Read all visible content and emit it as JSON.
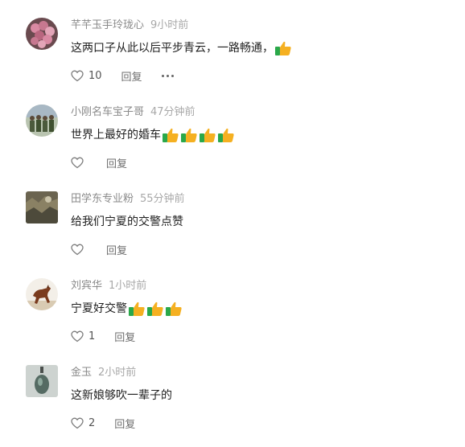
{
  "comments": [
    {
      "username": "芊芊玉手玲珑心",
      "time": "9小时前",
      "text": "这两口子从此以后平步青云，一路畅通，",
      "emoji_count": 1,
      "likes": "10",
      "reply_label": "回复",
      "has_more": true,
      "avatar": "flower-bouquet"
    },
    {
      "username": "小刚名车宝子哥",
      "time": "47分钟前",
      "text": "世界上最好的婚车",
      "emoji_count": 4,
      "likes": "",
      "reply_label": "回复",
      "has_more": false,
      "avatar": "people-group"
    },
    {
      "username": "田学东专业粉",
      "time": "55分钟前",
      "text": "给我们宁夏的交警点赞",
      "emoji_count": 0,
      "likes": "",
      "reply_label": "回复",
      "has_more": false,
      "avatar": "landscape"
    },
    {
      "username": "刘宾华",
      "time": "1小时前",
      "text": "宁夏好交警",
      "emoji_count": 3,
      "likes": "1",
      "reply_label": "回复",
      "has_more": false,
      "avatar": "running-horse"
    },
    {
      "username": "金玉",
      "time": "2小时前",
      "text": "这新娘够吹一辈子的",
      "emoji_count": 0,
      "likes": "2",
      "reply_label": "回复",
      "has_more": false,
      "avatar": "jade-pendant"
    }
  ],
  "icons": {
    "like": "heart-outline-icon",
    "more": "ellipsis-icon",
    "emoji": "thumbs-up-emoji"
  },
  "colors": {
    "username": "#8a8a8a",
    "text": "#1f1f1f",
    "thumb": "#f5b021",
    "cuff": "#2aa84a"
  }
}
